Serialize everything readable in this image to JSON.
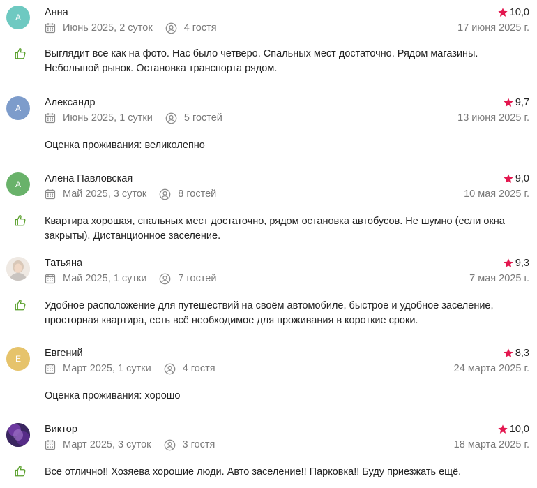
{
  "colors": {
    "star": "#e3174f",
    "like": "#5aa02c",
    "muted_text": "#7a7a7a",
    "avatar_anna": "#6ec9c1",
    "avatar_aleksandr": "#7d9ccb",
    "avatar_alena": "#69b26a",
    "avatar_evgeniy": "#e6c36b"
  },
  "icons": {
    "calendar": "calendar-icon",
    "guests": "user-circle-icon",
    "rating": "star-icon",
    "like": "thumbs-up-icon"
  },
  "reviews": [
    {
      "avatar_letter": "А",
      "name": "Анна",
      "rating": "10,0",
      "period": "Июнь 2025, 2 суток",
      "guests": "4 гостя",
      "date": "17 июня 2025 г.",
      "liked": true,
      "text": "Выглядит все как на фото. Нас было четверо. Спальных мест достаточно. Рядом магазины. Небольшой рынок. Остановка транспорта рядом."
    },
    {
      "avatar_letter": "А",
      "name": "Александр",
      "rating": "9,7",
      "period": "Июнь 2025, 1 сутки",
      "guests": "5 гостей",
      "date": "13 июня 2025 г.",
      "liked": false,
      "text": "Оценка проживания: великолепно"
    },
    {
      "avatar_letter": "А",
      "name": "Алена Павловская",
      "rating": "9,0",
      "period": "Май 2025, 3 суток",
      "guests": "8 гостей",
      "date": "10 мая 2025 г.",
      "liked": true,
      "text": "Квартира хорошая, спальных мест достаточно, рядом остановка автобусов. Не шумно (если окна закрыты). Дистанционное заселение."
    },
    {
      "avatar_letter": "",
      "name": "Татьяна",
      "rating": "9,3",
      "period": "Май 2025, 1 сутки",
      "guests": "7 гостей",
      "date": "7 мая 2025 г.",
      "liked": true,
      "text": "Удобное расположение для путешествий на своём автомобиле, быстрое и удобное заселение, просторная квартира, есть всё необходимое для проживания в короткие сроки."
    },
    {
      "avatar_letter": "Е",
      "name": "Евгений",
      "rating": "8,3",
      "period": "Март 2025, 1 сутки",
      "guests": "4 гостя",
      "date": "24 марта 2025 г.",
      "liked": false,
      "text": "Оценка проживания: хорошо"
    },
    {
      "avatar_letter": "",
      "name": "Виктор",
      "rating": "10,0",
      "period": "Март 2025, 3 суток",
      "guests": "3 гостя",
      "date": "18 марта 2025 г.",
      "liked": true,
      "text": "Все отлично!! Хозяева хорошие люди. Авто заселение!! Парковка!! Буду приезжать ещё."
    }
  ]
}
